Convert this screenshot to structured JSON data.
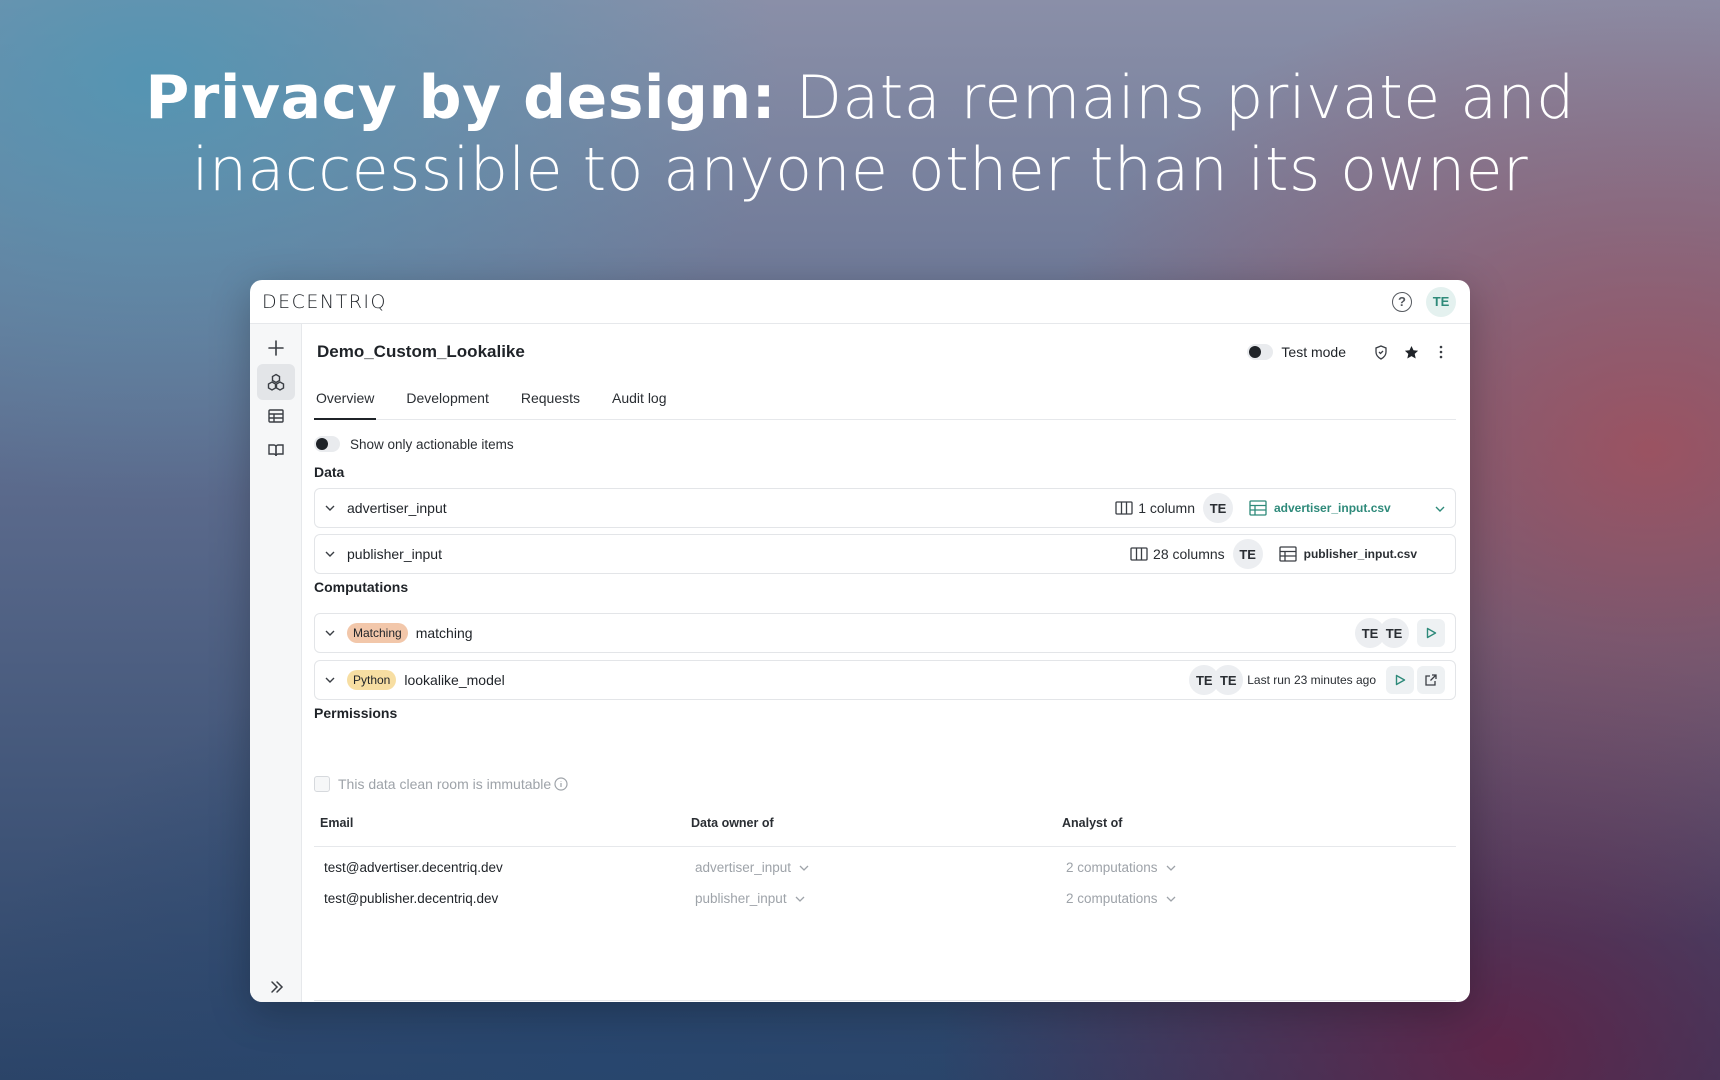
{
  "headline": {
    "bold": "Privacy by design:",
    "rest_line1": " Data remains private and",
    "line2": "inaccessible to anyone other than its owner"
  },
  "app": {
    "logo": "DECENTRIQ",
    "user_initials": "TE",
    "help_icon": "question-circle-icon",
    "accent_color": "#2e8a7a"
  },
  "sidebar": {
    "icons": [
      "plus-icon",
      "cubes-icon",
      "table-icon",
      "book-icon"
    ],
    "active_index": 1,
    "expand_icon": "double-chevron-right-icon"
  },
  "header": {
    "title": "Demo_Custom_Lookalike",
    "test_mode_label": "Test mode"
  },
  "tabs": [
    {
      "label": "Overview",
      "active": true
    },
    {
      "label": "Development",
      "active": false
    },
    {
      "label": "Requests",
      "active": false
    },
    {
      "label": "Audit log",
      "active": false
    }
  ],
  "actionable_toggle_label": "Show only actionable items",
  "data_section": {
    "label": "Data",
    "rows": [
      {
        "name": "advertiser_input",
        "columns": "1 column",
        "owner": "TE",
        "file": "advertiser_input.csv"
      },
      {
        "name": "publisher_input",
        "columns": "28 columns",
        "owner": "TE",
        "file": "publisher_input.csv"
      }
    ]
  },
  "computations_section": {
    "label": "Computations",
    "rows": [
      {
        "badge": "Matching",
        "name": "matching",
        "users": [
          "TE",
          "TE"
        ],
        "last_run": ""
      },
      {
        "badge": "Python",
        "name": "lookalike_model",
        "users": [
          "TE",
          "TE"
        ],
        "last_run": "Last run 23 minutes ago"
      }
    ]
  },
  "permissions": {
    "label": "Permissions",
    "immutable_label": "This data clean room is immutable",
    "columns": [
      "Email",
      "Data owner of",
      "Analyst of"
    ],
    "rows": [
      {
        "email": "test@advertiser.decentriq.dev",
        "owner_of": "advertiser_input",
        "analyst_of": "2 computations"
      },
      {
        "email": "test@publisher.decentriq.dev",
        "owner_of": "publisher_input",
        "analyst_of": "2 computations"
      }
    ]
  }
}
